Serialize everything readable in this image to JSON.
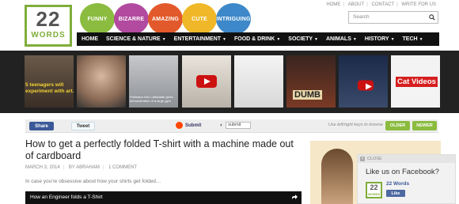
{
  "logo": {
    "number": "22",
    "word": "WORDS"
  },
  "categories": [
    {
      "label": "FUNNY",
      "color": "#8bbc3f"
    },
    {
      "label": "BIZARRE",
      "color": "#b24aa0"
    },
    {
      "label": "AMAZING",
      "color": "#e25a2b"
    },
    {
      "label": "CUTE",
      "color": "#f0b828"
    },
    {
      "label": "INTRIGUING",
      "color": "#3d88c8"
    }
  ],
  "top_links": [
    "HOME",
    "ABOUT",
    "CONTACT",
    "WRITE FOR US"
  ],
  "search": {
    "placeholder": "Search"
  },
  "nav": [
    {
      "label": "HOME",
      "dropdown": false
    },
    {
      "label": "SCIENCE & NATURE",
      "dropdown": true
    },
    {
      "label": "ENTERTAINMENT",
      "dropdown": true
    },
    {
      "label": "FOOD & DRINK",
      "dropdown": true
    },
    {
      "label": "SOCIETY",
      "dropdown": true
    },
    {
      "label": "ANIMALS",
      "dropdown": true
    },
    {
      "label": "HISTORY",
      "dropdown": true
    },
    {
      "label": "TECH",
      "dropdown": true
    }
  ],
  "carousel": {
    "thumb1_text": "5 teenagers will\nexperiment with art.",
    "thumb3_caption": "Professor Eric Laithwaite gives\ndemonstration of a large gyro",
    "thumb7_text": "DUMB",
    "thumb9_text": "Cat Videos"
  },
  "share_bar": {
    "facebook": "Share",
    "twitter": "Tweet",
    "reddit": "Submit",
    "stumble": "submit",
    "hint": "Use left/right keys to browse",
    "older": "OLDER",
    "newer": "NEWER"
  },
  "article": {
    "title": "How to get a perfectly folded T-shirt with a machine made out of cardboard",
    "date": "MARCH 3, 2014",
    "author": "BY ABRAHAM",
    "comments": "1 COMMENT",
    "excerpt": "In case you're obsessive about how your shirts get folded…",
    "video_title": "How an Engineer folds a T-Shirt"
  },
  "fb_popup": {
    "close": "CLOSE",
    "heading": "Like us on Facebook?",
    "page_name": "22 Words",
    "like": "Like"
  }
}
